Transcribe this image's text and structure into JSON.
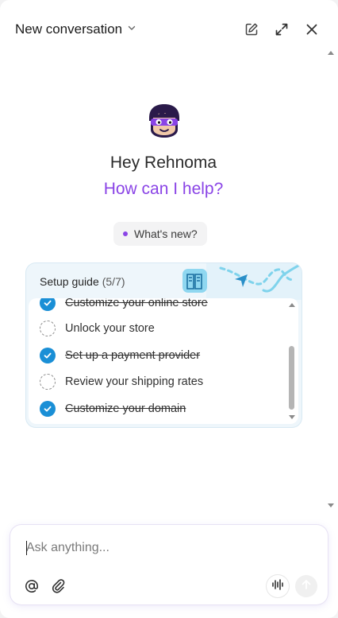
{
  "header": {
    "title": "New conversation",
    "icons": [
      "chevron-down-icon",
      "edit-icon",
      "expand-icon",
      "close-icon"
    ]
  },
  "hero": {
    "greeting": "Hey Rehnoma",
    "subtitle": "How can I help?"
  },
  "whats_new": {
    "label": "What's new?"
  },
  "setup_guide": {
    "title": "Setup guide",
    "progress": "(5/7)",
    "tasks": [
      {
        "label": "Customize your online store",
        "done": true
      },
      {
        "label": "Unlock your store",
        "done": false
      },
      {
        "label": "Set up a payment provider",
        "done": true
      },
      {
        "label": "Review your shipping rates",
        "done": false
      },
      {
        "label": "Customize your domain",
        "done": true
      }
    ]
  },
  "composer": {
    "placeholder": "Ask anything...",
    "value": "",
    "icons": [
      "at-sign-icon",
      "paperclip-icon",
      "voice-icon",
      "send-arrow-icon"
    ]
  },
  "colors": {
    "accent": "#8a44e6",
    "check": "#1a8fd6",
    "guide_bg": "#eef6fb"
  }
}
